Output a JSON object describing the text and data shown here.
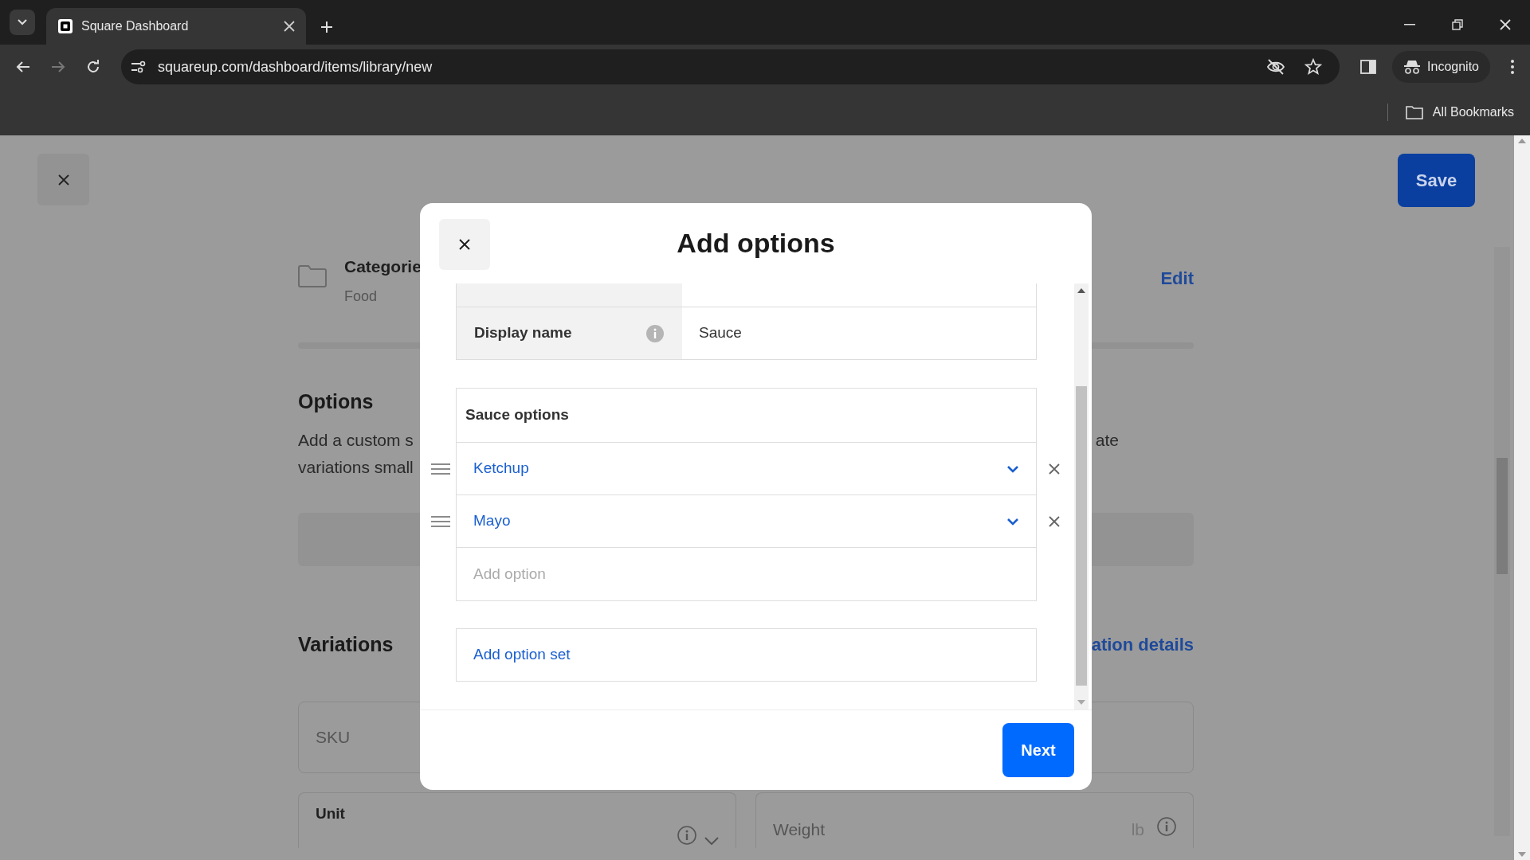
{
  "browser": {
    "tab_title": "Square Dashboard",
    "url": "squareup.com/dashboard/items/library/new",
    "profile": "Incognito",
    "bookmarks": "All Bookmarks"
  },
  "page": {
    "save": "Save",
    "category_label": "Categorie",
    "category_value": "Food",
    "edit": "Edit",
    "options_heading": "Options",
    "options_line1_left": "Add a custom s",
    "options_line1_right": "ate",
    "options_line2_left": "variations small",
    "variations_heading": "Variations",
    "variations_link": "ation details",
    "sku_placeholder": "SKU",
    "unit_label": "Unit",
    "weight_placeholder": "Weight",
    "weight_unit": "lb"
  },
  "modal": {
    "title": "Add options",
    "display_name": {
      "label": "Display name",
      "value": "Sauce"
    },
    "option_set": {
      "title": "Sauce options",
      "options": [
        {
          "value": "Ketchup"
        },
        {
          "value": "Mayo"
        }
      ],
      "add_placeholder": "Add option"
    },
    "add_option_set": "Add option set",
    "next": "Next"
  }
}
